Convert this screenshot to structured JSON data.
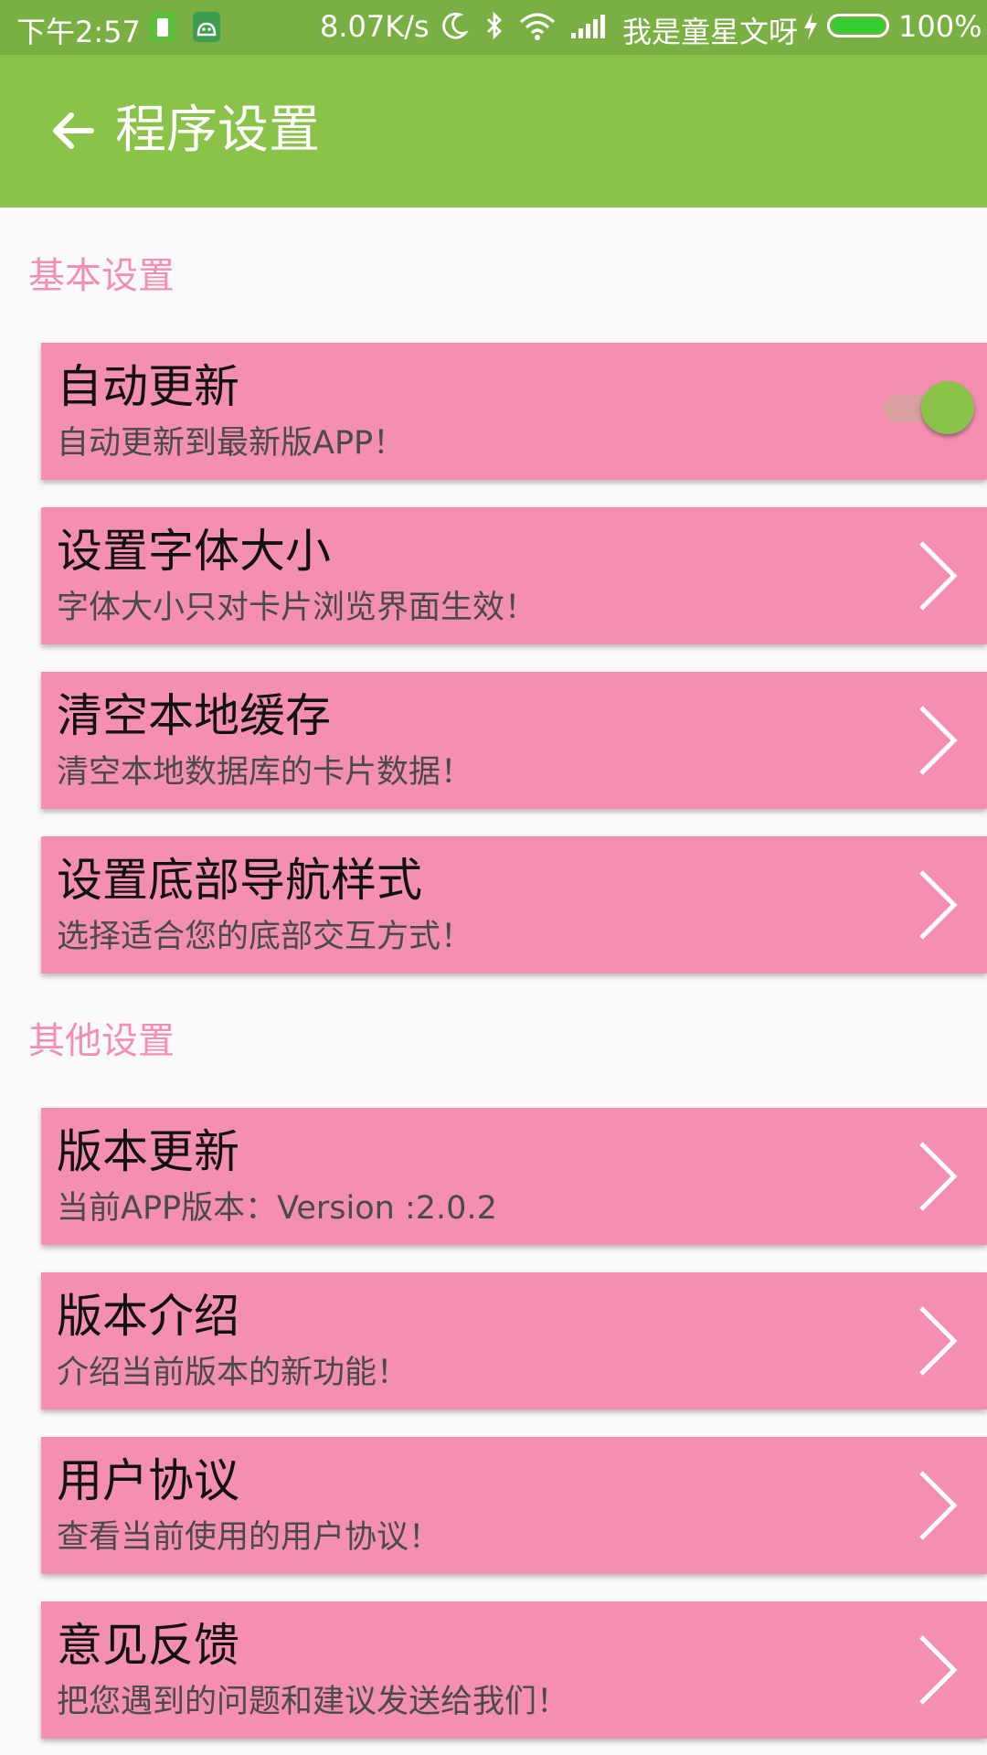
{
  "status_bar": {
    "time": "下午2:57",
    "speed": "8.07K/s",
    "carrier": "我是童星文呀",
    "battery_percent": "100%",
    "battery_level": 1.0,
    "icons": [
      "sim-icon",
      "android-icon",
      "moon-icon",
      "bluetooth-icon",
      "wifi-icon",
      "signal-icon",
      "charging-icon",
      "battery-icon"
    ]
  },
  "app_bar": {
    "title": "程序设置",
    "back_icon": "arrow-left-icon"
  },
  "sections": [
    {
      "header": "基本设置",
      "items": [
        {
          "title": "自动更新",
          "subtitle": "自动更新到最新版APP！",
          "control": "toggle",
          "toggle_on": true
        },
        {
          "title": "设置字体大小",
          "subtitle": "字体大小只对卡片浏览界面生效！",
          "control": "chevron"
        },
        {
          "title": "清空本地缓存",
          "subtitle": "清空本地数据库的卡片数据！",
          "control": "chevron"
        },
        {
          "title": "设置底部导航样式",
          "subtitle": "选择适合您的底部交互方式！",
          "control": "chevron"
        }
      ]
    },
    {
      "header": "其他设置",
      "items": [
        {
          "title": "版本更新",
          "subtitle": "当前APP版本：Version :2.0.2",
          "control": "chevron"
        },
        {
          "title": "版本介绍",
          "subtitle": "介绍当前版本的新功能！",
          "control": "chevron"
        },
        {
          "title": "用户协议",
          "subtitle": "查看当前使用的用户协议！",
          "control": "chevron"
        },
        {
          "title": "意见反馈",
          "subtitle": "把您遇到的问题和建议发送给我们！",
          "control": "chevron"
        }
      ]
    }
  ],
  "colors": {
    "status_bar": "#7ab043",
    "app_bar": "#8bc34a",
    "card": "#f48fb1",
    "section_header": "#f48fb1",
    "toggle_thumb": "#8bc34a"
  }
}
